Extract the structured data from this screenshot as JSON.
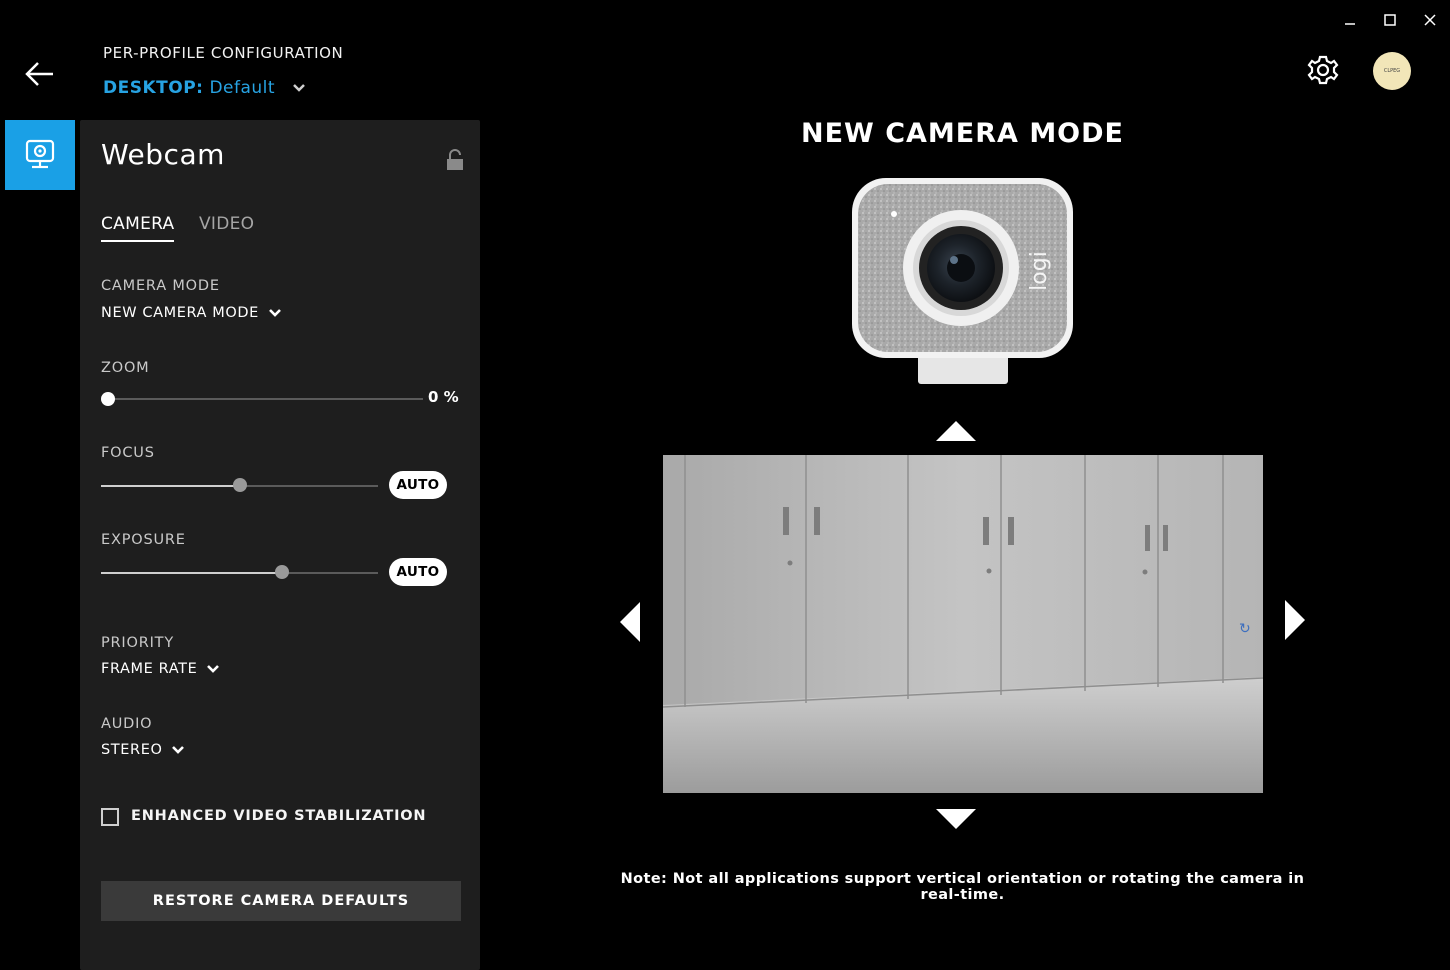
{
  "window": {
    "controls": [
      "minimize",
      "maximize",
      "close"
    ]
  },
  "header": {
    "caption": "PER-PROFILE CONFIGURATION",
    "profile_device": "DESKTOP:",
    "profile_name": "Default",
    "avatar_text": "CLPEG"
  },
  "device": {
    "name": "Webcam",
    "icons": {
      "rail": "webcam-icon",
      "lock": "unlock-icon"
    }
  },
  "tabs": [
    {
      "label": "CAMERA",
      "active": true
    },
    {
      "label": "VIDEO",
      "active": false
    }
  ],
  "settings": {
    "camera_mode": {
      "label": "CAMERA MODE",
      "value": "NEW CAMERA MODE"
    },
    "zoom": {
      "label": "ZOOM",
      "value_number": "0",
      "unit": "%",
      "fraction": 0.0
    },
    "focus": {
      "label": "FOCUS",
      "fraction": 0.5,
      "auto_label": "AUTO"
    },
    "exposure": {
      "label": "EXPOSURE",
      "fraction": 0.66,
      "auto_label": "AUTO"
    },
    "priority": {
      "label": "PRIORITY",
      "value": "FRAME RATE"
    },
    "audio": {
      "label": "AUDIO",
      "value": "STEREO"
    },
    "stabilization": {
      "label": "ENHANCED VIDEO STABILIZATION",
      "checked": false
    },
    "restore_label": "RESTORE CAMERA DEFAULTS"
  },
  "main": {
    "title": "NEW CAMERA MODE",
    "camera_brand": "logi",
    "note": "Note: Not all applications support vertical orientation or rotating the camera in real-time."
  },
  "colors": {
    "accent": "#1aa0e6",
    "profile_text": "#27a3e3",
    "panel_bg": "#1e1e1e",
    "restore_bg": "#3a3a3a"
  }
}
